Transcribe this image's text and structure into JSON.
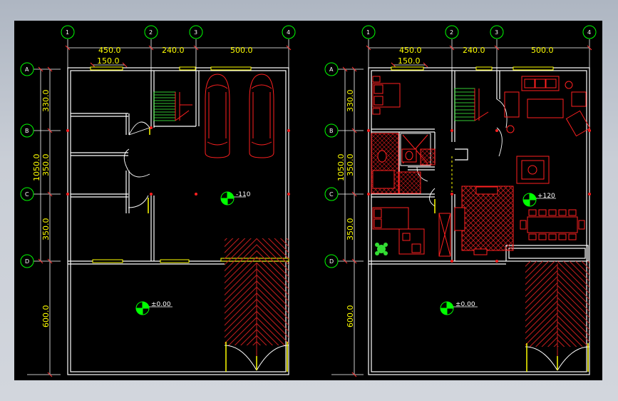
{
  "colors": {
    "background": "#000000",
    "wall": "#ffffff",
    "dimension": "#ffff00",
    "grid_bubble": "#00ff00",
    "furniture": "#ff2020",
    "hatch": "#c81e1e",
    "stair": "#40ff40"
  },
  "plans": [
    {
      "id": "ground-floor",
      "grid_columns": [
        "1",
        "2",
        "3",
        "4"
      ],
      "grid_rows": [
        "A",
        "B",
        "C",
        "D"
      ],
      "top_dims": [
        "450.0",
        "240.0",
        "500.0"
      ],
      "top_subdim": "150.0",
      "left_dims": [
        "330.0",
        "350.0",
        "350.0",
        "600.0"
      ],
      "left_total": "1050.0",
      "level_marks": [
        "-110",
        "±0.00"
      ]
    },
    {
      "id": "first-floor",
      "grid_columns": [
        "1",
        "2",
        "3",
        "4"
      ],
      "grid_rows": [
        "A",
        "B",
        "C",
        "D"
      ],
      "top_dims": [
        "450.0",
        "240.0",
        "500.0"
      ],
      "top_subdim": "150.0",
      "left_dims": [
        "330.0",
        "350.0",
        "350.0",
        "600.0"
      ],
      "left_total": "1050.0",
      "level_marks": [
        "+120",
        "±0.00"
      ]
    }
  ]
}
